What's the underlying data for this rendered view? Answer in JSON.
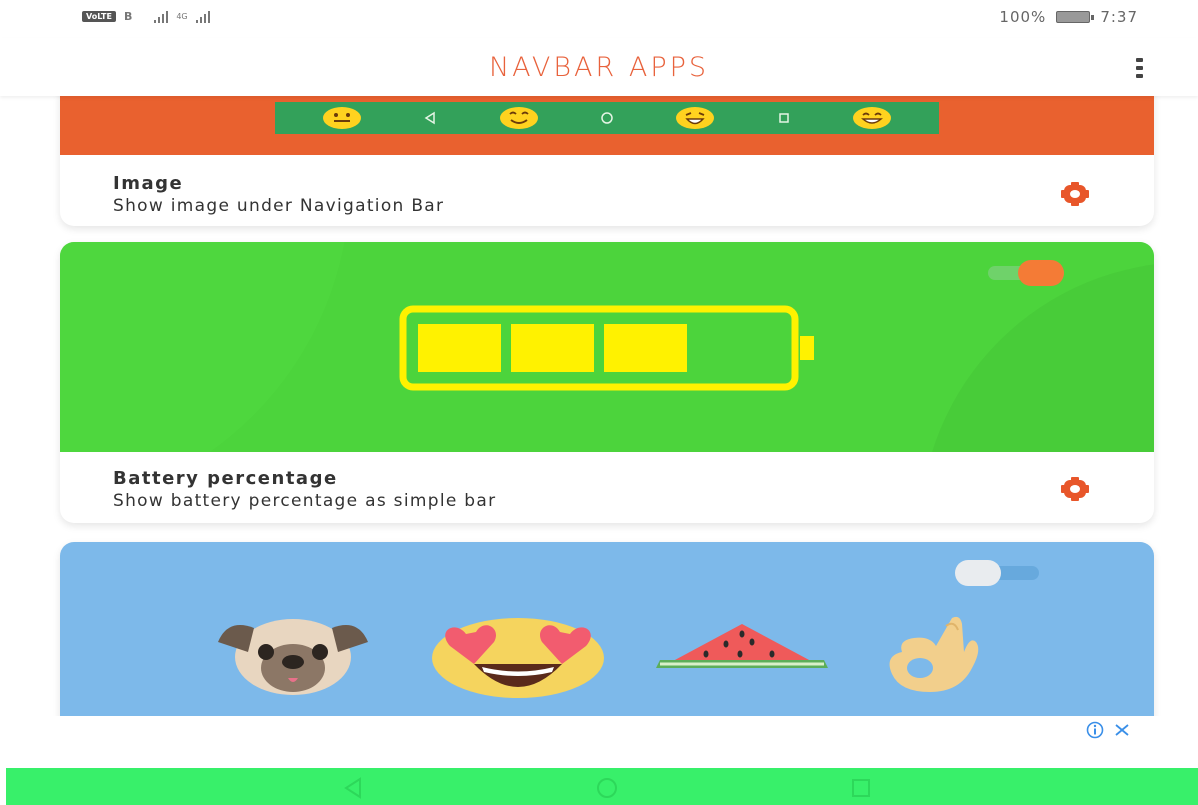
{
  "status_bar": {
    "volte": "VoLTE",
    "sim_label": "B",
    "network": "4G",
    "battery_percent": "100%",
    "time": "7:37"
  },
  "app_bar": {
    "title": "NAVBAR APPS",
    "menu_icon": "more-vert-icon"
  },
  "cards": [
    {
      "title": "Image",
      "subtitle": "Show image under Navigation Bar",
      "banner_color": "#e9612f",
      "settings_icon": "gear-icon"
    },
    {
      "title": "Battery percentage",
      "subtitle": "Show battery percentage as simple bar",
      "banner_color": "#4cd43c",
      "settings_icon": "gear-icon",
      "toggle_on": true,
      "battery_fill_fraction": 0.75
    },
    {
      "banner_color": "#7db9ea",
      "toggle_on": false,
      "emojis": [
        "pug-face-icon",
        "heart-eyes-emoji-icon",
        "watermelon-icon",
        "ok-hand-icon"
      ]
    }
  ],
  "ad": {
    "info_icon": "ad-info-icon",
    "close_icon": "ad-close-icon"
  },
  "system_nav": {
    "buttons": [
      "back-icon",
      "home-icon",
      "recents-icon"
    ],
    "color": "#38f06a"
  },
  "colors": {
    "accent": "#e8623c",
    "gear": "#e8562a",
    "toggle_on_knob": "#f47b36",
    "battery_yellow": "#fff200"
  }
}
